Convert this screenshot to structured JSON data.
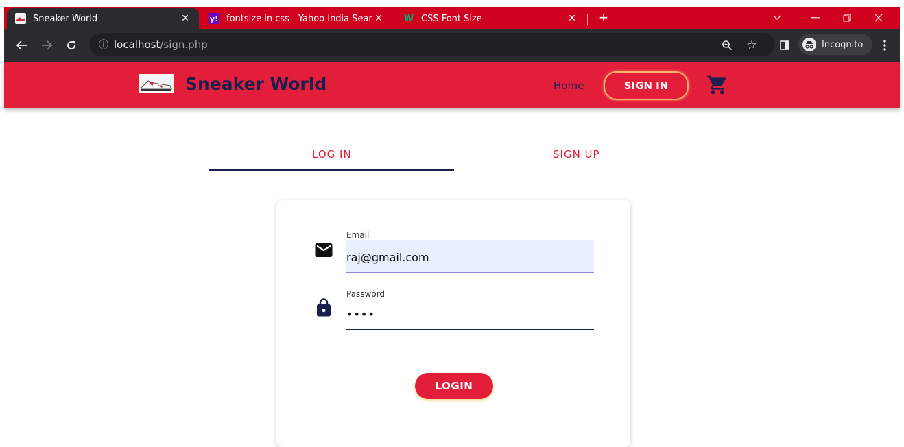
{
  "browser": {
    "tabs": [
      {
        "title": "Sneaker World",
        "active": true
      },
      {
        "title": "fontsize in css - Yahoo India Sear",
        "active": false
      },
      {
        "title": "CSS Font Size",
        "active": false
      }
    ],
    "tab_close": "✕",
    "new_tab": "+",
    "url_host": "localhost",
    "url_path": "/sign.php",
    "profile_label": "Incognito",
    "colors": {
      "tab_strip": "#d0001f",
      "toolbar": "#2b2c2f"
    }
  },
  "site": {
    "brand": "Sneaker World",
    "nav": {
      "home": "Home",
      "sign_in": "SIGN IN"
    },
    "colors": {
      "primary": "#e31e3b",
      "navy": "#1a1f4e",
      "accent": "#ffb36a"
    }
  },
  "auth": {
    "tabs": {
      "login": "LOG IN",
      "signup": "SIGN UP"
    },
    "email": {
      "label": "Email",
      "value": "raj@gmail.com"
    },
    "password": {
      "label": "Password",
      "value": "••••"
    },
    "submit": "LOGIN"
  }
}
